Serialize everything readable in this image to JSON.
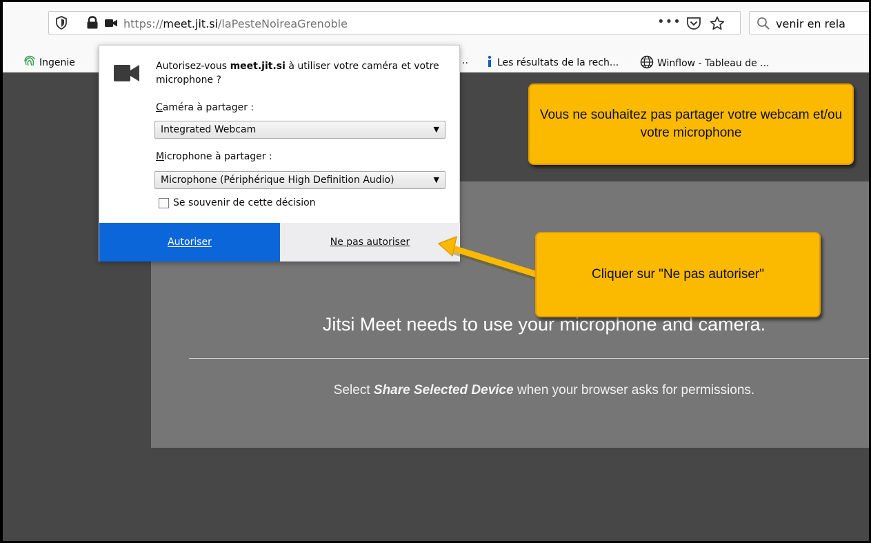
{
  "browser": {
    "url_scheme_path_before": "https://",
    "url_host": "meet.jit.si",
    "url_path": "/laPesteNoireaGrenoble",
    "page_actions_label": "•••",
    "search_value": "venir en rela"
  },
  "bookmarks": [
    {
      "label": "Ingenie"
    },
    {
      "label": ".."
    },
    {
      "label": "Les résultats de la rech..."
    },
    {
      "label": "Winflow - Tableau de ..."
    }
  ],
  "popup": {
    "question_prefix": "Autorisez-vous ",
    "question_host": "meet.jit.si",
    "question_suffix": " à utiliser votre caméra et votre microphone ?",
    "camera_label": "Caméra à partager :",
    "camera_value": "Integrated Webcam",
    "mic_label": "Microphone à partager :",
    "mic_value": "Microphone (Périphérique High Definition Audio)",
    "remember_label": "Se souvenir de cette décision",
    "allow_label": "Autoriser",
    "deny_label": "Ne pas autoriser"
  },
  "page": {
    "title": "Jitsi Meet needs to use your microphone and camera.",
    "hint_prefix": "Select ",
    "hint_bold": "Share Selected Device",
    "hint_suffix": " when your browser asks for permissions."
  },
  "callouts": {
    "top": "Vous ne souhaitez pas partager votre webcam et/ou votre microphone",
    "bottom": "Cliquer sur \"Ne pas autoriser\""
  },
  "colors": {
    "callout_fill": "#fbb900",
    "allow_button": "#0a66d9",
    "page_bg": "#474747",
    "card_bg": "#767676"
  },
  "icons": [
    "shield-icon",
    "lock-icon",
    "camera-icon",
    "pocket-icon",
    "star-icon",
    "search-icon",
    "globe-icon",
    "info-icon",
    "fingerprint-icon"
  ]
}
